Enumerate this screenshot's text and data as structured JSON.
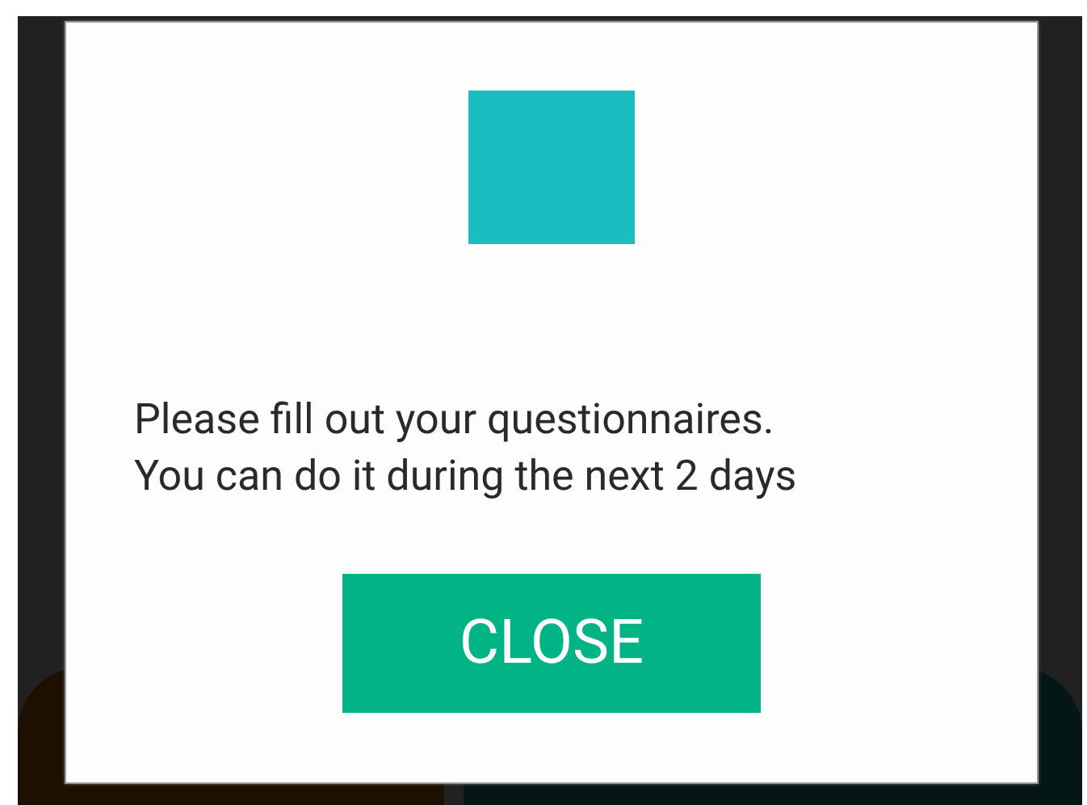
{
  "dialog": {
    "message_lines": [
      "Please fill out your questionnaires.",
      "You can do it during the next 2 days"
    ],
    "button": {
      "label": "CLOSE"
    }
  }
}
